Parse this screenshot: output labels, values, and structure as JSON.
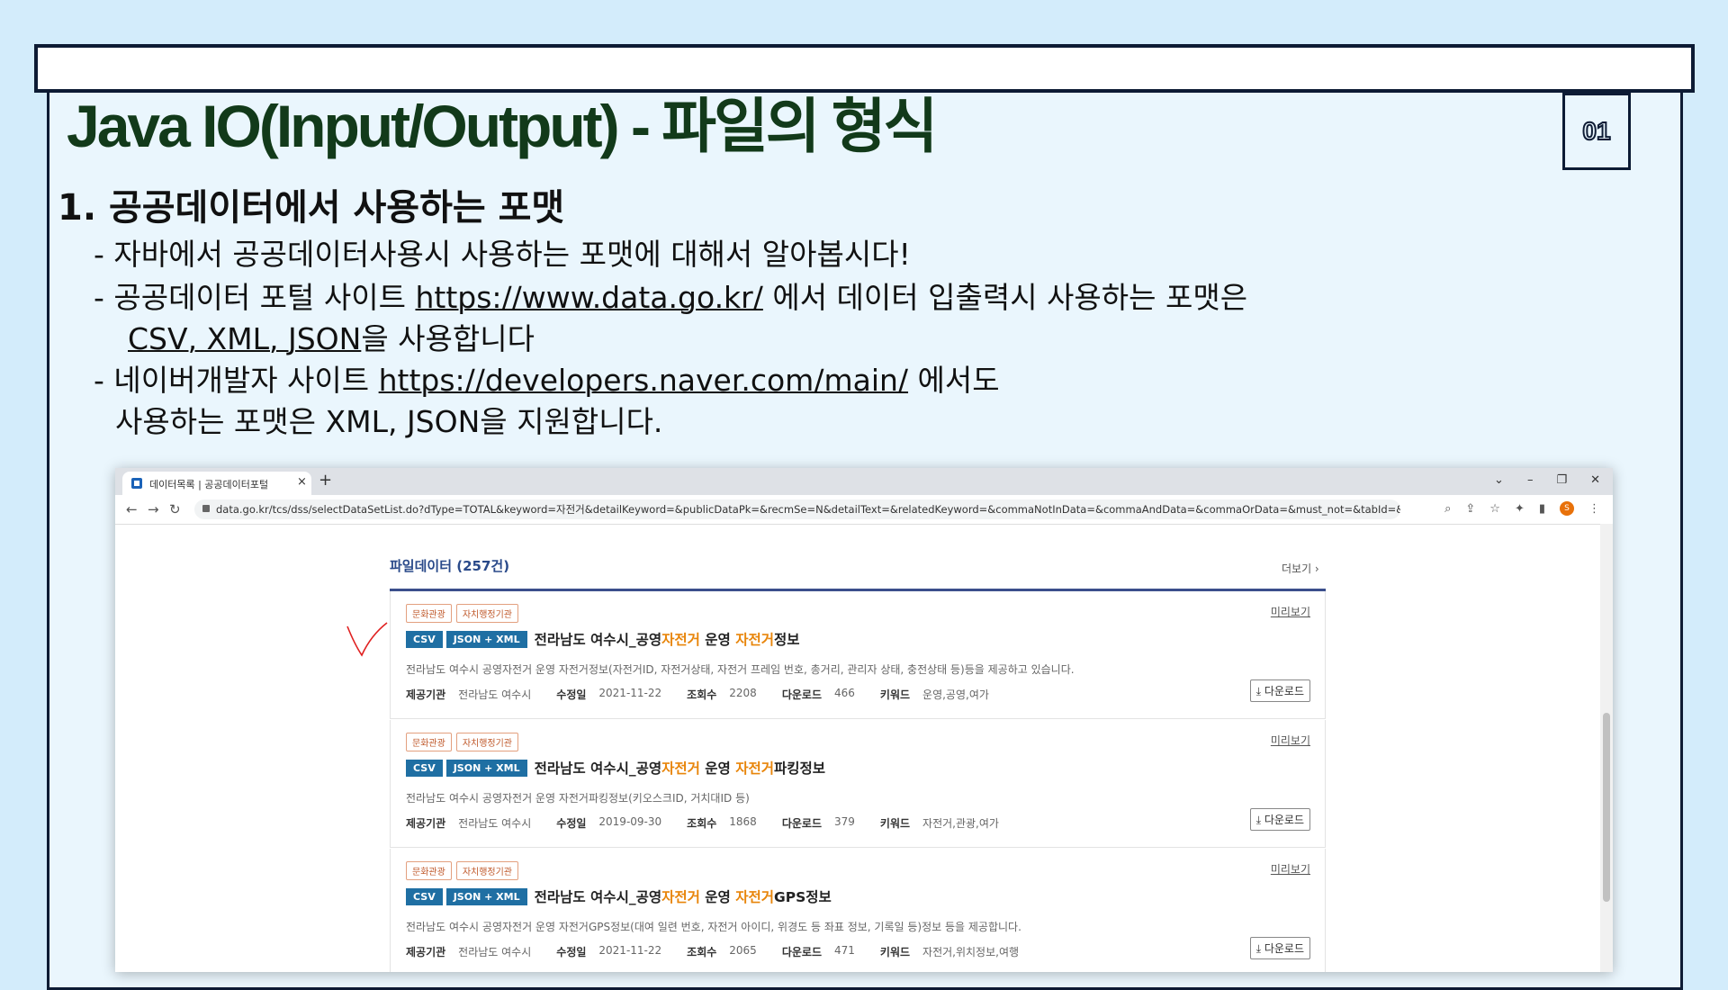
{
  "slide": {
    "title": "Java IO(Input/Output) - 파일의 형식",
    "page_number": "01",
    "section_heading": "1. 공공데이터에서 사용하는 포맷",
    "bullet1": "- 자바에서 공공데이터사용시 사용하는 포맷에 대해서 알아봅시다!",
    "bullet2_pre": "- 공공데이터 포털 사이트 ",
    "bullet2_link": "https://www.data.go.kr/",
    "bullet2_post": " 에서 데이터 입출력시 사용하는 포맷은",
    "bullet2b_u": "CSV, XML, JSON",
    "bullet2b_post": "을 사용합니다",
    "bullet3_pre": "- 네이버개발자 사이트 ",
    "bullet3_link": "https://developers.naver.com/main/",
    "bullet3_post": " 에서도",
    "bullet3b": "사용하는 포맷은 XML, JSON을 지원합니다."
  },
  "browser": {
    "tab_title": "데이터목록 | 공공데이터포털",
    "tab_close": "×",
    "new_tab": "+",
    "url": "data.go.kr/tcs/dss/selectDataSetList.do?dType=TOTAL&keyword=자전거&detailKeyword=&publicDataPk=&recmSe=N&detailText=&relatedKeyword=&commaNotInData=&commaAndData=&commaOrData=&must_not=&tabId=&dataSetCo...",
    "profile_initial": "S"
  },
  "content": {
    "list_heading": "파일데이터 (257건)",
    "more_label": "더보기 ›",
    "items": [
      {
        "badges": [
          "문화관광",
          "자치행정기관"
        ],
        "preview": "미리보기",
        "types": [
          "CSV",
          "JSON + XML"
        ],
        "title_a": "전라남도 여수시_공영",
        "title_hl1": "자전거",
        "title_b": " 운영 ",
        "title_hl2": "자전거",
        "title_c": "정보",
        "description": "전라남도 여수시 공영자전거 운영 자전거정보(자전거ID, 자전거상태, 자전거 프레임 번호, 총거리, 관리자 상태, 충전상태 등)등을 제공하고 있습니다.",
        "provider_label": "제공기관",
        "provider": "전라남도 여수시",
        "modified_label": "수정일",
        "modified": "2021-11-22",
        "views_label": "조회수",
        "views": "2208",
        "downloads_label": "다운로드",
        "downloads": "466",
        "keywords_label": "키워드",
        "keywords": "운영,공영,여가",
        "download_button": "다운로드"
      },
      {
        "badges": [
          "문화관광",
          "자치행정기관"
        ],
        "preview": "미리보기",
        "types": [
          "CSV",
          "JSON + XML"
        ],
        "title_a": "전라남도 여수시_공영",
        "title_hl1": "자전거",
        "title_b": " 운영 ",
        "title_hl2": "자전거",
        "title_c": "파킹정보",
        "description": "전라남도 여수시 공영자전거 운영 자전거파킹정보(키오스크ID, 거치대ID 등)",
        "provider_label": "제공기관",
        "provider": "전라남도 여수시",
        "modified_label": "수정일",
        "modified": "2019-09-30",
        "views_label": "조회수",
        "views": "1868",
        "downloads_label": "다운로드",
        "downloads": "379",
        "keywords_label": "키워드",
        "keywords": "자전거,관광,여가",
        "download_button": "다운로드"
      },
      {
        "badges": [
          "문화관광",
          "자치행정기관"
        ],
        "preview": "미리보기",
        "types": [
          "CSV",
          "JSON + XML"
        ],
        "title_a": "전라남도 여수시_공영",
        "title_hl1": "자전거",
        "title_b": " 운영 ",
        "title_hl2": "자전거",
        "title_c": "GPS정보",
        "description": "전라남도 여수시 공영자전거 운영 자전거GPS정보(대여 일련 번호, 자전거 아이디, 위경도 등 좌표 정보, 기록일 등)정보 등을 제공합니다.",
        "provider_label": "제공기관",
        "provider": "전라남도 여수시",
        "modified_label": "수정일",
        "modified": "2021-11-22",
        "views_label": "조회수",
        "views": "2065",
        "downloads_label": "다운로드",
        "downloads": "471",
        "keywords_label": "키워드",
        "keywords": "자전거,위치정보,여행",
        "download_button": "다운로드"
      }
    ]
  },
  "colors": {
    "accent_orange": "#e8850a",
    "type_badge": "#1f6fa3",
    "frame": "#0d1b34"
  }
}
